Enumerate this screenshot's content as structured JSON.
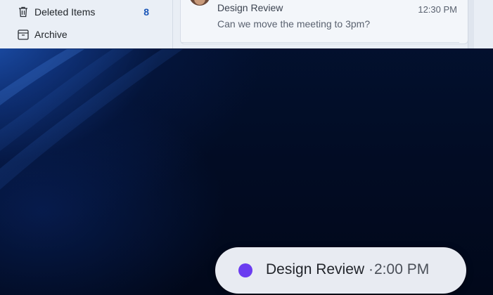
{
  "mail": {
    "folders": [
      {
        "label": "Deleted Items",
        "count": "8",
        "icon": "trash-icon"
      },
      {
        "label": "Archive",
        "count": "",
        "icon": "archive-icon"
      }
    ],
    "message": {
      "sender": "Design Review",
      "preview": "Can we move the meeting to 3pm?",
      "time": "12:30 PM",
      "avatar": "avatar"
    }
  },
  "toast": {
    "title": "Design Review",
    "separator": "·",
    "time": "2:00 PM",
    "accent_color": "#6b3cf0"
  },
  "colors": {
    "count_blue": "#1a56b8",
    "wallpaper_dark": "#020b1f",
    "wallpaper_glow": "#215abe"
  }
}
